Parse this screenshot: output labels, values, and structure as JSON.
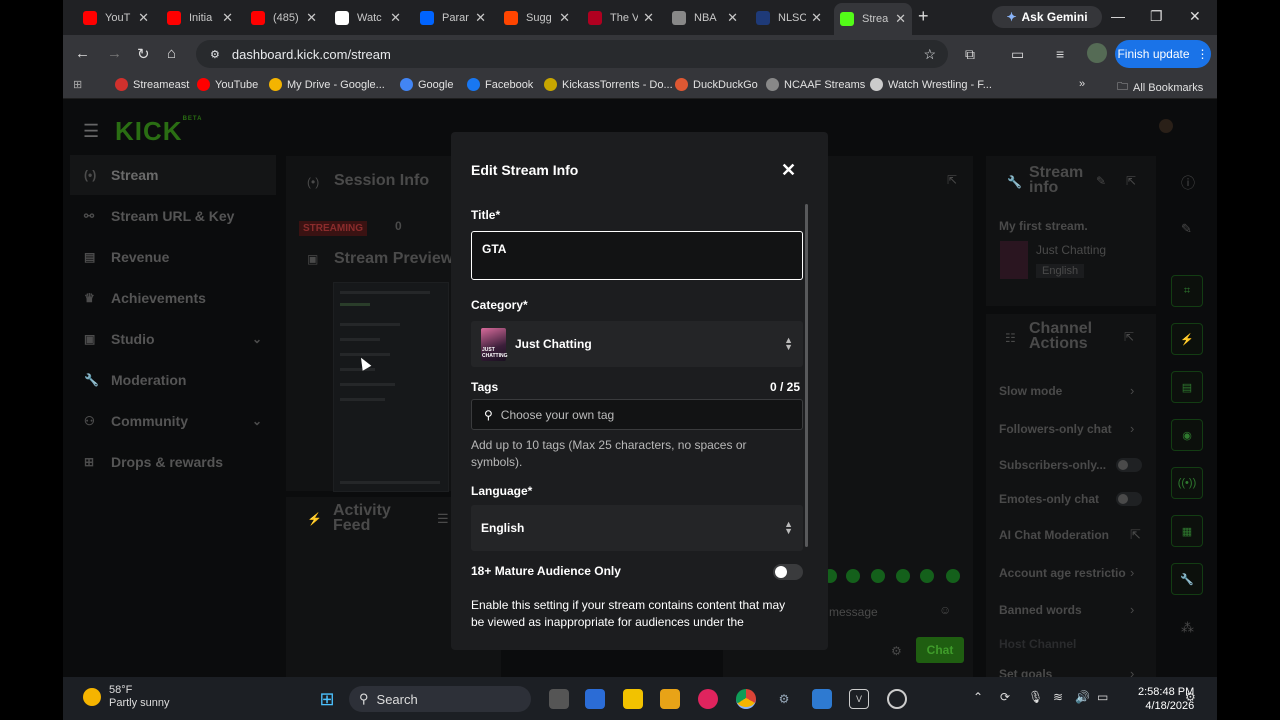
{
  "browser": {
    "tabs": [
      {
        "label": "YouT",
        "icon": "youtube-icon",
        "color": "#ff0000"
      },
      {
        "label": "Initia",
        "icon": "youtube-icon",
        "color": "#ff0000"
      },
      {
        "label": "(485)",
        "icon": "youtube-icon",
        "color": "#ff0000"
      },
      {
        "label": "Watc",
        "icon": "doc-icon",
        "color": "#ffffff"
      },
      {
        "label": "Parar",
        "icon": "paramount-icon",
        "color": "#0064ff"
      },
      {
        "label": "Sugg",
        "icon": "reddit-icon",
        "color": "#ff4500"
      },
      {
        "label": "The V",
        "icon": "verge-icon",
        "color": "#b00020"
      },
      {
        "label": "NBA",
        "icon": "globe-icon",
        "color": "#888888"
      },
      {
        "label": "NLSC",
        "icon": "nlsc-icon",
        "color": "#1e3a78"
      },
      {
        "label": "Strea",
        "icon": "kick-icon",
        "color": "#53fc18"
      }
    ],
    "ask_gemini": "Ask Gemini",
    "url": "dashboard.kick.com/stream",
    "finish_update": "Finish update",
    "bookmarks": [
      {
        "label": "Streameast",
        "color": "#d0312d"
      },
      {
        "label": "YouTube",
        "color": "#ff0000"
      },
      {
        "label": "My Drive - Google...",
        "color": "#f4b400"
      },
      {
        "label": "Google",
        "color": "#4285f4"
      },
      {
        "label": "Facebook",
        "color": "#1877f2"
      },
      {
        "label": "KickassTorrents - Do...",
        "color": "#c8a600"
      },
      {
        "label": "DuckDuckGo",
        "color": "#de5833"
      },
      {
        "label": "NCAAF Streams",
        "color": "#888888"
      },
      {
        "label": "Watch Wrestling - F...",
        "color": "#cccccc"
      }
    ],
    "all_bookmarks": "All Bookmarks"
  },
  "kick": {
    "logo": "KICK",
    "logo_sup": "BETA",
    "sidebar": [
      {
        "label": "Stream",
        "icon": "stream-icon",
        "active": true
      },
      {
        "label": "Stream URL & Key",
        "icon": "link-icon"
      },
      {
        "label": "Revenue",
        "icon": "revenue-icon"
      },
      {
        "label": "Achievements",
        "icon": "trophy-icon"
      },
      {
        "label": "Studio",
        "icon": "studio-icon",
        "chevron": true
      },
      {
        "label": "Moderation",
        "icon": "wrench-icon"
      },
      {
        "label": "Community",
        "icon": "community-icon",
        "chevron": true
      },
      {
        "label": "Drops & rewards",
        "icon": "drops-icon"
      }
    ],
    "session_info": "Session Info",
    "streaming_badge": "STREAMING",
    "viewer_count": "0",
    "stream_preview": "Stream Preview",
    "activity_feed": "Activity Feed",
    "chat_placeholder": "message",
    "chat_button": "Chat",
    "stream_info": {
      "heading": "Stream info",
      "title": "My first stream.",
      "category": "Just Chatting",
      "language": "English"
    },
    "channel_actions": {
      "heading": "Channel Actions",
      "items": [
        {
          "label": "Slow mode",
          "kind": "chevron"
        },
        {
          "label": "Followers-only chat",
          "kind": "chevron"
        },
        {
          "label": "Subscribers-only...",
          "kind": "toggle"
        },
        {
          "label": "Emotes-only chat",
          "kind": "toggle"
        },
        {
          "label": "AI Chat Moderation",
          "kind": "external"
        },
        {
          "label": "Account age restrictio",
          "kind": "chevron"
        },
        {
          "label": "Banned words",
          "kind": "chevron"
        },
        {
          "label": "Host Channel",
          "kind": "none"
        },
        {
          "label": "Set goals",
          "kind": "chevron"
        }
      ]
    }
  },
  "modal": {
    "heading": "Edit Stream Info",
    "title_label": "Title*",
    "title_value": "GTA",
    "category_label": "Category*",
    "category_value": "Just Chatting",
    "category_thumb_text": "JUST CHATTING",
    "tags_label": "Tags",
    "tags_count": "0 / 25",
    "tags_placeholder": "Choose your own tag",
    "tags_help": "Add up to 10 tags (Max 25 characters, no spaces or symbols).",
    "language_label": "Language*",
    "language_value": "English",
    "mature_label": "18+ Mature Audience Only",
    "mature_enabled": false,
    "mature_desc": "Enable this setting if your stream contains content that may be viewed as inappropriate for audiences under the"
  },
  "taskbar": {
    "temp": "58°F",
    "weather": "Partly sunny",
    "search": "Search",
    "time": "2:58:48 PM",
    "date": "4/18/2026"
  }
}
